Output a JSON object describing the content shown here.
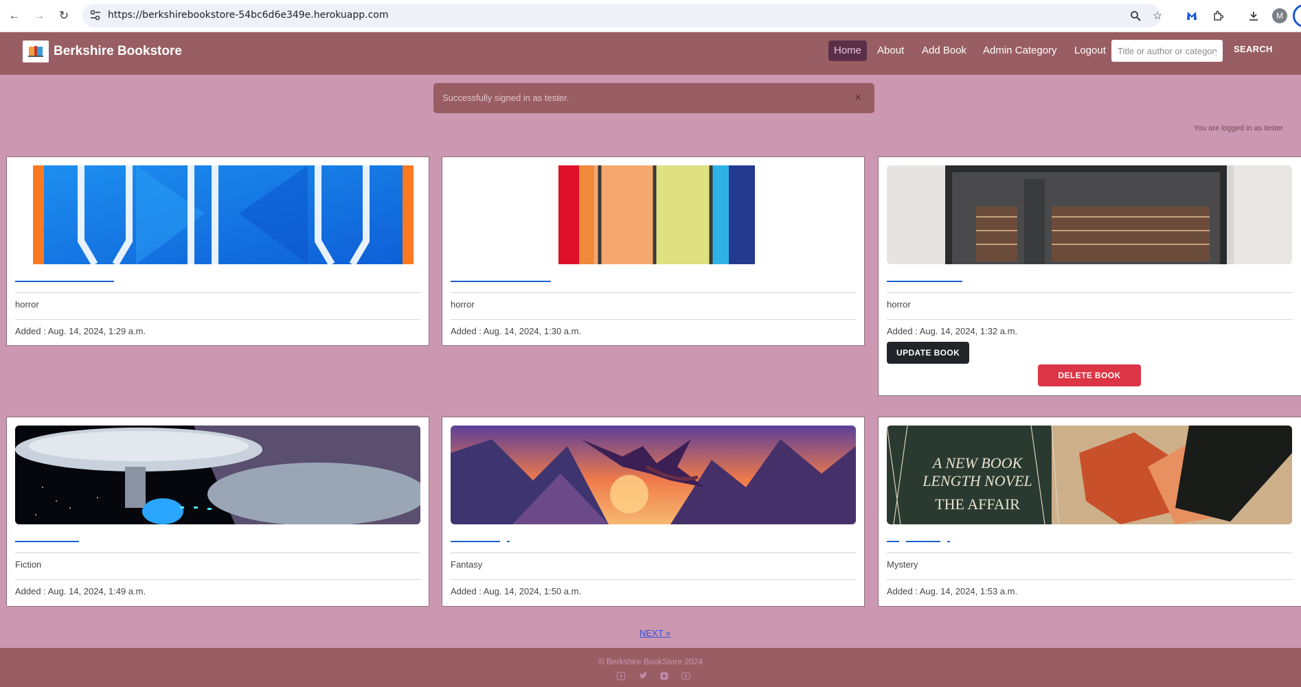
{
  "browser": {
    "url": "https://berkshirebookstore-54bc6d6e349e.herokuapp.com",
    "avatar_letter": "M"
  },
  "navbar": {
    "brand": "Berkshire Bookstore",
    "links": [
      "Home",
      "About",
      "Add Book",
      "Admin Category",
      "Logout"
    ],
    "active": "Home",
    "search_placeholder": "Title or author or category",
    "search_label": "SEARCH"
  },
  "alert": {
    "message": "Successfully signed in as tester.",
    "close_icon": "×"
  },
  "login_status": "You are logged in as tester",
  "books": [
    {
      "category": "horror",
      "added": "Added : Aug. 14, 2024, 1:29 a.m."
    },
    {
      "category": "horror",
      "added": "Added : Aug. 14, 2024, 1:30 a.m."
    },
    {
      "category": "horror",
      "added": "Added : Aug. 14, 2024, 1:32 a.m.",
      "update_label": "UPDATE BOOK",
      "delete_label": "DELETE BOOK"
    },
    {
      "category": "Fiction",
      "added": "Added : Aug. 14, 2024, 1:49 a.m."
    },
    {
      "category": "Fantasy",
      "added": "Added : Aug. 14, 2024, 1:50 a.m."
    },
    {
      "category": "Mystery",
      "added": "Added : Aug. 14, 2024, 1:53 a.m.",
      "cover_text": [
        "A NEW BOOK",
        "LENGTH NOVEL",
        "THE AFFAIR"
      ]
    }
  ],
  "pagination": {
    "next_label": "NEXT »"
  },
  "footer": {
    "copyright": "© Berkshire BookStore 2024",
    "social_icons": [
      "facebook-icon",
      "twitter-icon",
      "instagram-icon",
      "youtube-icon"
    ]
  },
  "colors": {
    "page_bg": "#cc98b1",
    "navbar_bg": "#985e63",
    "active_link_bg": "#5b2f48",
    "update_button": "#212529",
    "delete_button": "#dc3545",
    "link_blue": "#1a5fcf"
  }
}
